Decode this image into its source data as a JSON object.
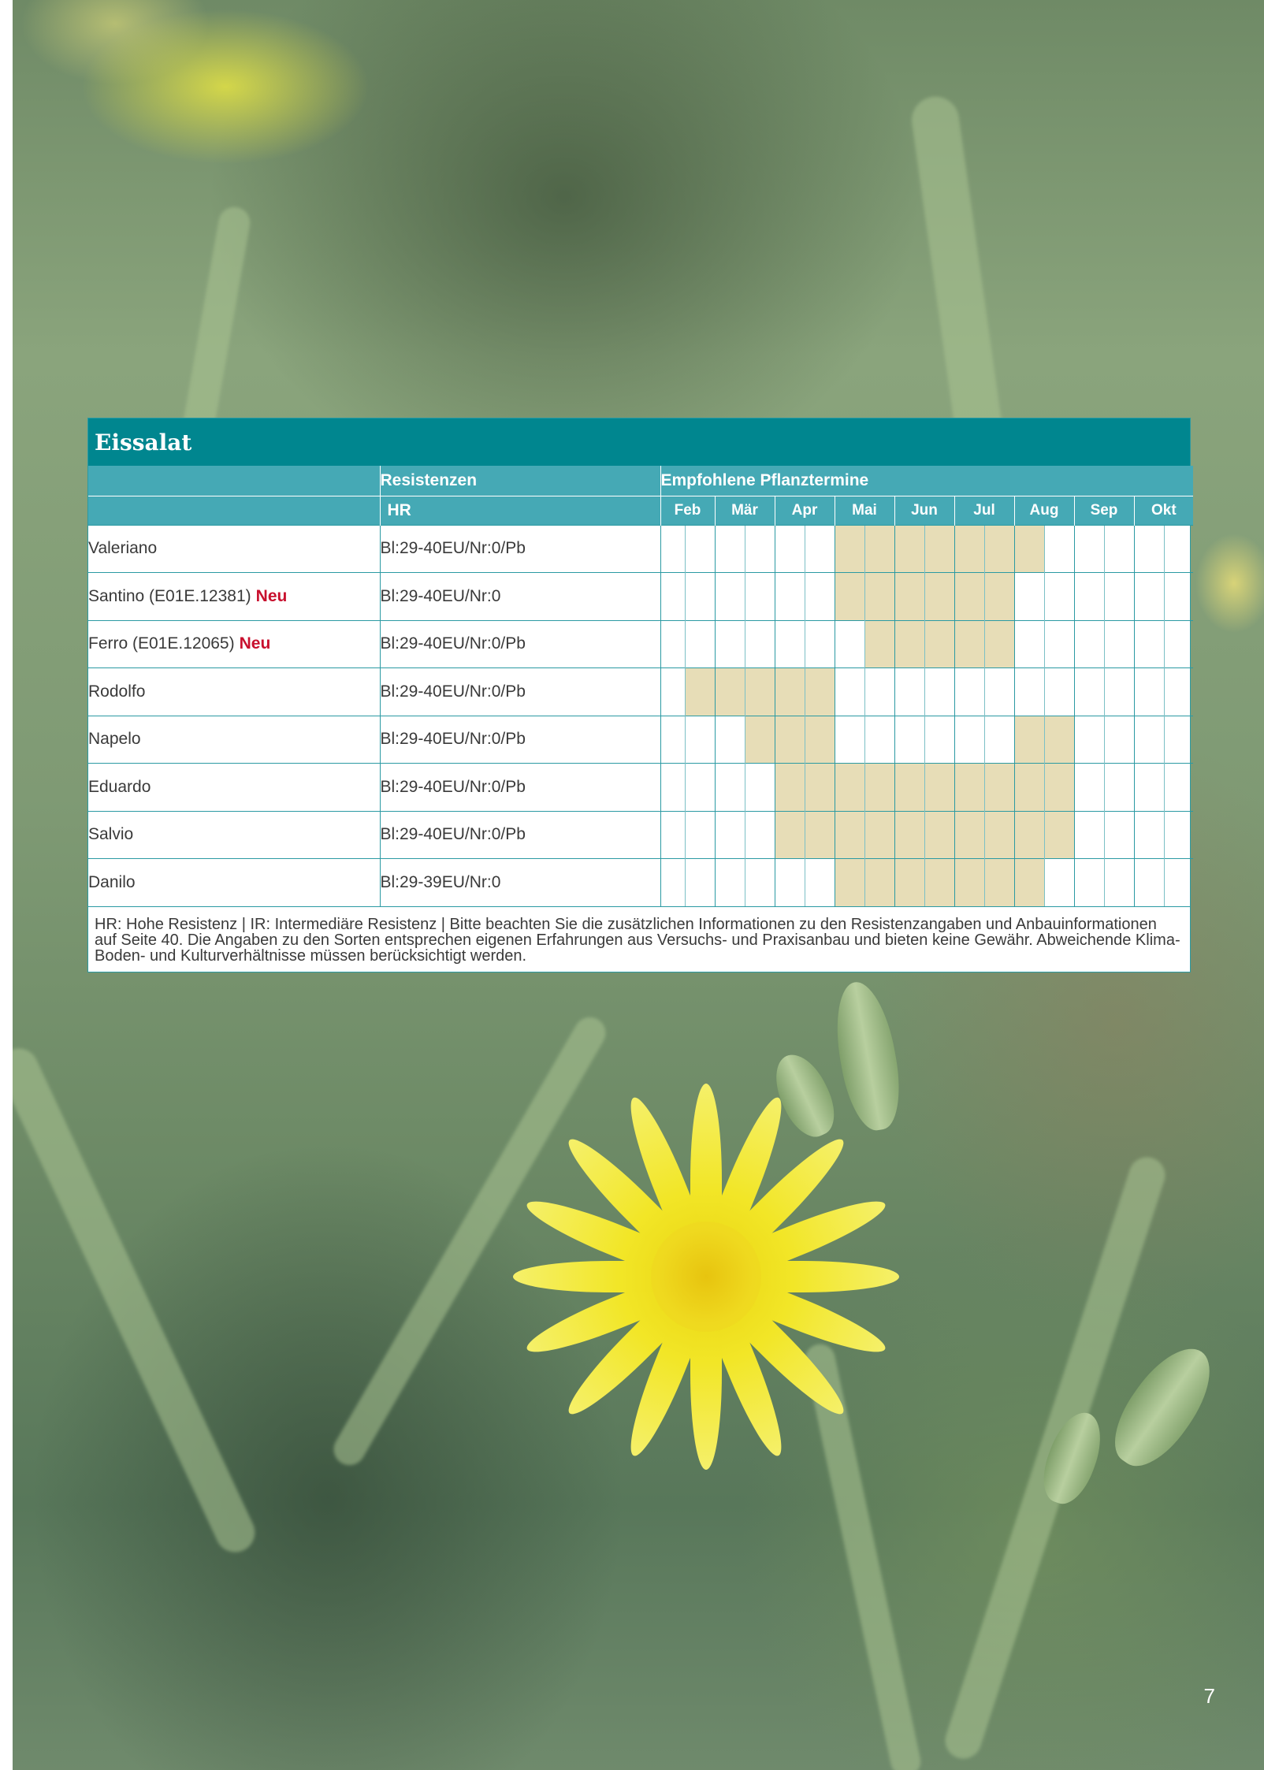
{
  "table": {
    "title": "Eissalat",
    "resistances_header": "Resistenzen",
    "planting_header": "Empfohlene Pflanztermine",
    "hr_label": "HR",
    "months": [
      "Feb",
      "Mär",
      "Apr",
      "Mai",
      "Jun",
      "Jul",
      "Aug",
      "Sep",
      "Okt"
    ],
    "rows": [
      {
        "name": "Valeriano",
        "badge": "",
        "resistance": "Bl:29-40EU/Nr:0/Pb",
        "schedule": [
          0,
          0,
          0,
          0,
          0,
          0,
          1,
          1,
          1,
          1,
          1,
          1,
          1,
          0,
          0,
          0,
          0,
          0
        ]
      },
      {
        "name": "Santino (E01E.12381)",
        "badge": "Neu",
        "resistance": "Bl:29-40EU/Nr:0",
        "schedule": [
          0,
          0,
          0,
          0,
          0,
          0,
          1,
          1,
          1,
          1,
          1,
          1,
          0,
          0,
          0,
          0,
          0,
          0
        ]
      },
      {
        "name": "Ferro (E01E.12065)",
        "badge": "Neu",
        "resistance": "Bl:29-40EU/Nr:0/Pb",
        "schedule": [
          0,
          0,
          0,
          0,
          0,
          0,
          0,
          1,
          1,
          1,
          1,
          1,
          0,
          0,
          0,
          0,
          0,
          0
        ]
      },
      {
        "name": "Rodolfo",
        "badge": "",
        "resistance": "Bl:29-40EU/Nr:0/Pb",
        "schedule": [
          0,
          1,
          1,
          1,
          1,
          1,
          0,
          0,
          0,
          0,
          0,
          0,
          0,
          0,
          0,
          0,
          0,
          0
        ]
      },
      {
        "name": "Napelo",
        "badge": "",
        "resistance": "Bl:29-40EU/Nr:0/Pb",
        "schedule": [
          0,
          0,
          0,
          1,
          1,
          1,
          0,
          0,
          0,
          0,
          0,
          0,
          1,
          1,
          0,
          0,
          0,
          0
        ]
      },
      {
        "name": "Eduardo",
        "badge": "",
        "resistance": "Bl:29-40EU/Nr:0/Pb",
        "schedule": [
          0,
          0,
          0,
          0,
          1,
          1,
          1,
          1,
          1,
          1,
          1,
          1,
          1,
          1,
          0,
          0,
          0,
          0
        ]
      },
      {
        "name": "Salvio",
        "badge": "",
        "resistance": "Bl:29-40EU/Nr:0/Pb",
        "schedule": [
          0,
          0,
          0,
          0,
          1,
          1,
          1,
          1,
          1,
          1,
          1,
          1,
          1,
          1,
          0,
          0,
          0,
          0
        ]
      },
      {
        "name": "Danilo",
        "badge": "",
        "resistance": "Bl:29-39EU/Nr:0",
        "schedule": [
          0,
          0,
          0,
          0,
          0,
          0,
          1,
          1,
          1,
          1,
          1,
          1,
          1,
          0,
          0,
          0,
          0,
          0
        ]
      }
    ],
    "footnote": "HR: Hohe Resistenz | IR: Intermediäre Resistenz | Bitte beachten Sie die zusätzlichen Informationen zu den Resistenzangaben und Anbauinformationen auf Seite 40. Die Angaben zu den Sorten entsprechen eigenen Erfahrungen aus Versuchs- und Praxisanbau und bieten keine Gewähr. Abweichende Klima- Boden- und Kulturverhältnisse müssen berücksichtigt werden."
  },
  "page_number": "7",
  "colors": {
    "title_bar": "#00868f",
    "header_bar": "#45a9b5",
    "grid_line": "#2b9aa3",
    "planting_fill": "#e7ddb7",
    "new_badge": "#c8102e"
  }
}
